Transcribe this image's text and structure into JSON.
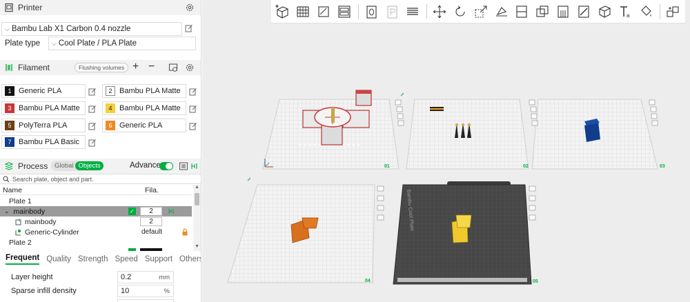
{
  "printer": {
    "title": "Printer",
    "name": "Bambu Lab X1 Carbon 0.4 nozzle",
    "plate_type_label": "Plate type",
    "plate_type_value": "Cool Plate / PLA Plate"
  },
  "filament": {
    "title": "Filament",
    "flushing_label": "Flushing volumes",
    "add_symbol": "+",
    "remove_symbol": "−",
    "slots": [
      {
        "num": "1",
        "name": "Generic PLA",
        "color": "#111111",
        "text_color": "#ffffff"
      },
      {
        "num": "2",
        "name": "Bambu PLA Matte",
        "color": "#ffffff",
        "text_color": "#222222"
      },
      {
        "num": "3",
        "name": "Bambu PLA Matte",
        "color": "#c8363a",
        "text_color": "#ffffff"
      },
      {
        "num": "4",
        "name": "Bambu PLA Matte",
        "color": "#f5d03b",
        "text_color": "#222222"
      },
      {
        "num": "5",
        "name": "PolyTerra PLA",
        "color": "#6b3f13",
        "text_color": "#ffffff"
      },
      {
        "num": "6",
        "name": "Generic PLA",
        "color": "#f08a24",
        "text_color": "#ffffff"
      },
      {
        "num": "7",
        "name": "Bambu PLA Basic",
        "color": "#123d8c",
        "text_color": "#ffffff"
      }
    ]
  },
  "process": {
    "title": "Process",
    "global_label": "Global",
    "objects_label": "Objects",
    "advance_label": "Advance",
    "search_placeholder": "Search plate, object and part.",
    "col_name": "Name",
    "col_fila": "Fila.",
    "tree": [
      {
        "label": "Plate 1",
        "indent": 0,
        "arrow": "⌄",
        "fila": "",
        "selected": false
      },
      {
        "label": "mainbody",
        "indent": 1,
        "arrow": "⌄",
        "fila": "2",
        "selected": true
      },
      {
        "label": "mainbody",
        "indent": 2,
        "arrow": "",
        "fila": "2",
        "selected": false
      },
      {
        "label": "Generic-Cylinder",
        "indent": 2,
        "arrow": "",
        "fila": "default",
        "selected": false
      },
      {
        "label": "Plate 2",
        "indent": 0,
        "arrow": "⌄",
        "fila": "",
        "selected": false
      }
    ],
    "tabs": [
      "Frequent",
      "Quality",
      "Strength",
      "Speed",
      "Support",
      "Others"
    ],
    "active_tab": "Frequent",
    "params": [
      {
        "label": "Layer height",
        "value": "0.2",
        "unit": "mm"
      },
      {
        "label": "Sparse infill density",
        "value": "10",
        "unit": "%"
      }
    ]
  },
  "plates": [
    {
      "label": "01"
    },
    {
      "label": "02"
    },
    {
      "label": "03"
    },
    {
      "label": "04"
    },
    {
      "label": "05",
      "bed_text": "Bambu Cool Plate"
    }
  ],
  "colors": {
    "accent": "#00ae42",
    "selected_row": "#9b9b9b",
    "lock_icon": "#f08a24"
  }
}
